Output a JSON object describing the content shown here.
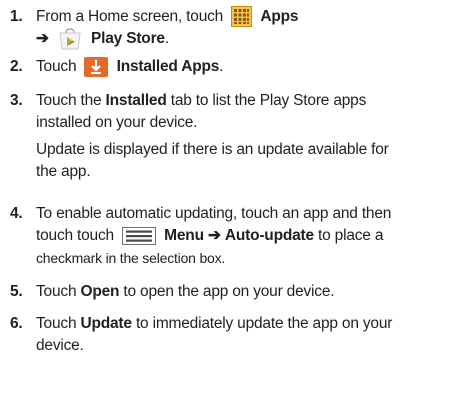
{
  "steps": [
    {
      "number": "1.",
      "line1": {
        "prefix": "From a Home screen, touch",
        "icon": "apps-grid-icon",
        "bold": "Apps"
      },
      "line2": {
        "arrow": "➔",
        "icon": "play-store-icon",
        "bold": "Play Store",
        "suffix": "."
      }
    },
    {
      "number": "2.",
      "line1": {
        "prefix": "Touch",
        "icon": "download-icon",
        "bold": "Installed Apps",
        "suffix": "."
      }
    },
    {
      "number": "3.",
      "lines": [
        {
          "prefix": "Touch the",
          "bold": "Installed",
          "suffix": "tab to list the Play Store apps"
        },
        {
          "text": "installed on your device."
        }
      ],
      "note_lines": [
        "Update is displayed if there is an update available for",
        "the app."
      ]
    },
    {
      "number": "4.",
      "line1": "To enable automatic updating, touch an app and then",
      "line2": {
        "prefix": "touch touch",
        "icon": "menu-icon",
        "bold1": "Menu",
        "arrow": "➔",
        "bold2": "Auto-update",
        "suffix": "to place a"
      },
      "line3": "checkmark in the selection box."
    },
    {
      "number": "5.",
      "line1": {
        "prefix": "Touch",
        "bold": "Open",
        "suffix": "to open the app on your device."
      }
    },
    {
      "number": "6.",
      "line1": {
        "prefix": "Touch",
        "bold": "Update",
        "suffix": "to immediately update the app on your"
      },
      "line2": "device."
    }
  ],
  "colors": {
    "text": "#231f20",
    "apps_icon_fill": "#f5c24a",
    "install_icon_fill": "#e46a2a"
  }
}
